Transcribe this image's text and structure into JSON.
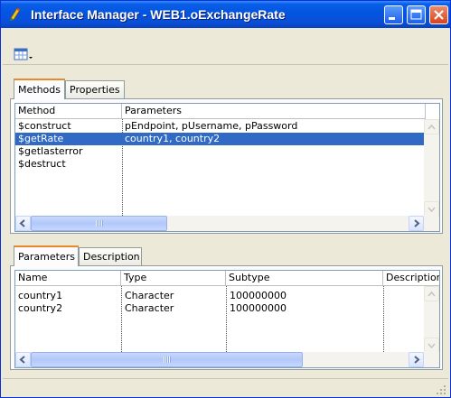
{
  "window": {
    "title": "Interface Manager - WEB1.oExchangeRate"
  },
  "toolbar": {
    "view_button_icon": "table-view-icon"
  },
  "upper_tabs": [
    {
      "label": "Methods",
      "active": true
    },
    {
      "label": "Properties",
      "active": false
    }
  ],
  "methods_grid": {
    "columns": [
      "Method",
      "Parameters"
    ],
    "rows": [
      {
        "method": "$construct",
        "parameters": "pEndpoint, pUsername, pPassword",
        "selected": false
      },
      {
        "method": "$getRate",
        "parameters": "country1, country2",
        "selected": true
      },
      {
        "method": "$getlasterror",
        "parameters": "",
        "selected": false
      },
      {
        "method": "$destruct",
        "parameters": "",
        "selected": false
      }
    ]
  },
  "lower_tabs": [
    {
      "label": "Parameters",
      "active": true
    },
    {
      "label": "Description",
      "active": false
    }
  ],
  "params_grid": {
    "columns": [
      "Name",
      "Type",
      "Subtype",
      "Description"
    ],
    "rows": [
      {
        "name": "country1",
        "type": "Character",
        "subtype": "100000000",
        "description": ""
      },
      {
        "name": "country2",
        "type": "Character",
        "subtype": "100000000",
        "description": ""
      }
    ]
  },
  "colors": {
    "selection": "#316ac5",
    "titlebar": "#0354e0",
    "active_tab_accent": "#e68b2c"
  }
}
